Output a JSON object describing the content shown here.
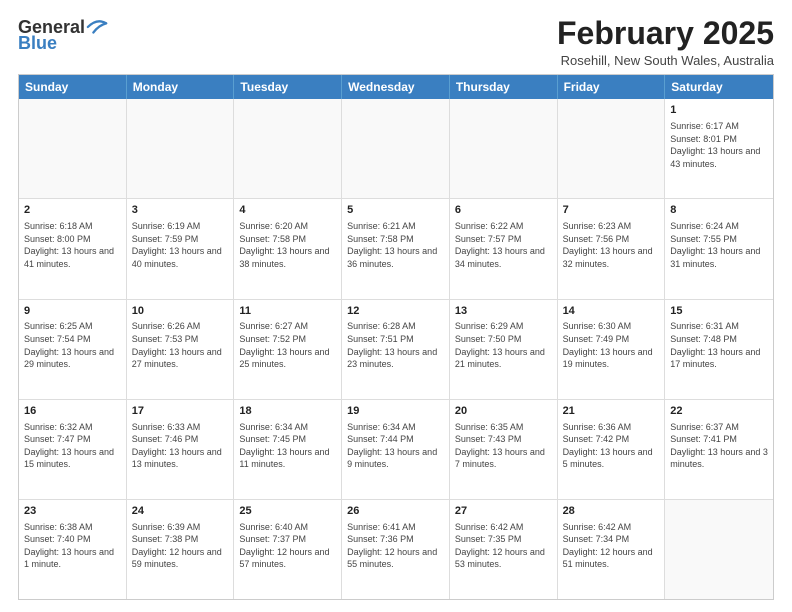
{
  "logo": {
    "general": "General",
    "blue": "Blue"
  },
  "title": "February 2025",
  "subtitle": "Rosehill, New South Wales, Australia",
  "weekdays": [
    "Sunday",
    "Monday",
    "Tuesday",
    "Wednesday",
    "Thursday",
    "Friday",
    "Saturday"
  ],
  "weeks": [
    [
      {
        "day": "",
        "text": ""
      },
      {
        "day": "",
        "text": ""
      },
      {
        "day": "",
        "text": ""
      },
      {
        "day": "",
        "text": ""
      },
      {
        "day": "",
        "text": ""
      },
      {
        "day": "",
        "text": ""
      },
      {
        "day": "1",
        "text": "Sunrise: 6:17 AM\nSunset: 8:01 PM\nDaylight: 13 hours and 43 minutes."
      }
    ],
    [
      {
        "day": "2",
        "text": "Sunrise: 6:18 AM\nSunset: 8:00 PM\nDaylight: 13 hours and 41 minutes."
      },
      {
        "day": "3",
        "text": "Sunrise: 6:19 AM\nSunset: 7:59 PM\nDaylight: 13 hours and 40 minutes."
      },
      {
        "day": "4",
        "text": "Sunrise: 6:20 AM\nSunset: 7:58 PM\nDaylight: 13 hours and 38 minutes."
      },
      {
        "day": "5",
        "text": "Sunrise: 6:21 AM\nSunset: 7:58 PM\nDaylight: 13 hours and 36 minutes."
      },
      {
        "day": "6",
        "text": "Sunrise: 6:22 AM\nSunset: 7:57 PM\nDaylight: 13 hours and 34 minutes."
      },
      {
        "day": "7",
        "text": "Sunrise: 6:23 AM\nSunset: 7:56 PM\nDaylight: 13 hours and 32 minutes."
      },
      {
        "day": "8",
        "text": "Sunrise: 6:24 AM\nSunset: 7:55 PM\nDaylight: 13 hours and 31 minutes."
      }
    ],
    [
      {
        "day": "9",
        "text": "Sunrise: 6:25 AM\nSunset: 7:54 PM\nDaylight: 13 hours and 29 minutes."
      },
      {
        "day": "10",
        "text": "Sunrise: 6:26 AM\nSunset: 7:53 PM\nDaylight: 13 hours and 27 minutes."
      },
      {
        "day": "11",
        "text": "Sunrise: 6:27 AM\nSunset: 7:52 PM\nDaylight: 13 hours and 25 minutes."
      },
      {
        "day": "12",
        "text": "Sunrise: 6:28 AM\nSunset: 7:51 PM\nDaylight: 13 hours and 23 minutes."
      },
      {
        "day": "13",
        "text": "Sunrise: 6:29 AM\nSunset: 7:50 PM\nDaylight: 13 hours and 21 minutes."
      },
      {
        "day": "14",
        "text": "Sunrise: 6:30 AM\nSunset: 7:49 PM\nDaylight: 13 hours and 19 minutes."
      },
      {
        "day": "15",
        "text": "Sunrise: 6:31 AM\nSunset: 7:48 PM\nDaylight: 13 hours and 17 minutes."
      }
    ],
    [
      {
        "day": "16",
        "text": "Sunrise: 6:32 AM\nSunset: 7:47 PM\nDaylight: 13 hours and 15 minutes."
      },
      {
        "day": "17",
        "text": "Sunrise: 6:33 AM\nSunset: 7:46 PM\nDaylight: 13 hours and 13 minutes."
      },
      {
        "day": "18",
        "text": "Sunrise: 6:34 AM\nSunset: 7:45 PM\nDaylight: 13 hours and 11 minutes."
      },
      {
        "day": "19",
        "text": "Sunrise: 6:34 AM\nSunset: 7:44 PM\nDaylight: 13 hours and 9 minutes."
      },
      {
        "day": "20",
        "text": "Sunrise: 6:35 AM\nSunset: 7:43 PM\nDaylight: 13 hours and 7 minutes."
      },
      {
        "day": "21",
        "text": "Sunrise: 6:36 AM\nSunset: 7:42 PM\nDaylight: 13 hours and 5 minutes."
      },
      {
        "day": "22",
        "text": "Sunrise: 6:37 AM\nSunset: 7:41 PM\nDaylight: 13 hours and 3 minutes."
      }
    ],
    [
      {
        "day": "23",
        "text": "Sunrise: 6:38 AM\nSunset: 7:40 PM\nDaylight: 13 hours and 1 minute."
      },
      {
        "day": "24",
        "text": "Sunrise: 6:39 AM\nSunset: 7:38 PM\nDaylight: 12 hours and 59 minutes."
      },
      {
        "day": "25",
        "text": "Sunrise: 6:40 AM\nSunset: 7:37 PM\nDaylight: 12 hours and 57 minutes."
      },
      {
        "day": "26",
        "text": "Sunrise: 6:41 AM\nSunset: 7:36 PM\nDaylight: 12 hours and 55 minutes."
      },
      {
        "day": "27",
        "text": "Sunrise: 6:42 AM\nSunset: 7:35 PM\nDaylight: 12 hours and 53 minutes."
      },
      {
        "day": "28",
        "text": "Sunrise: 6:42 AM\nSunset: 7:34 PM\nDaylight: 12 hours and 51 minutes."
      },
      {
        "day": "",
        "text": ""
      }
    ]
  ]
}
